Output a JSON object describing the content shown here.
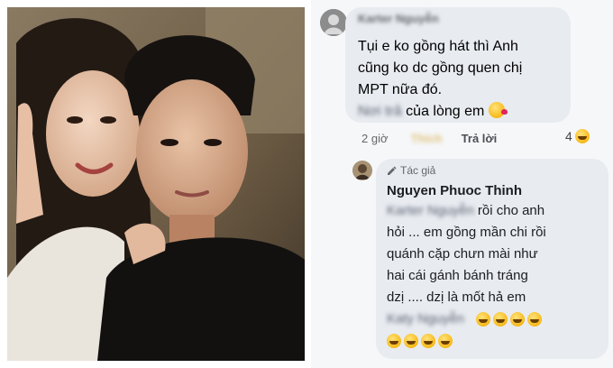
{
  "comments": [
    {
      "author_blurred": "Karter Nguyễn",
      "lines": [
        "Tụi e ko gồng hát thì Anh",
        "cũng ko dc gồng quen chị",
        "MPT nữa đó."
      ],
      "last_line_blurred": "Nơi trả",
      "last_line_text": " của lòng em",
      "time": "2 giờ",
      "like_blurred": "Thích",
      "reply": "Trả lời",
      "reaction_count": "4"
    },
    {
      "badge": "Tác giả",
      "author": "Nguyen Phuoc Thinh",
      "mention_blurred": "Karter Nguyễn",
      "line1_rest": " rồi cho anh",
      "lines": [
        "hỏi ... em gồng mần chi rồi",
        "quánh cặp chưn mài như",
        "hai cái gánh bánh tráng",
        "dzị .... dzị là mốt hả em"
      ],
      "mention2_blurred": "Katy Nguyễn"
    }
  ],
  "icons": {
    "kiss": "kissing-face-emoji",
    "laugh": "rofl-emoji",
    "pencil": "pencil-icon"
  }
}
